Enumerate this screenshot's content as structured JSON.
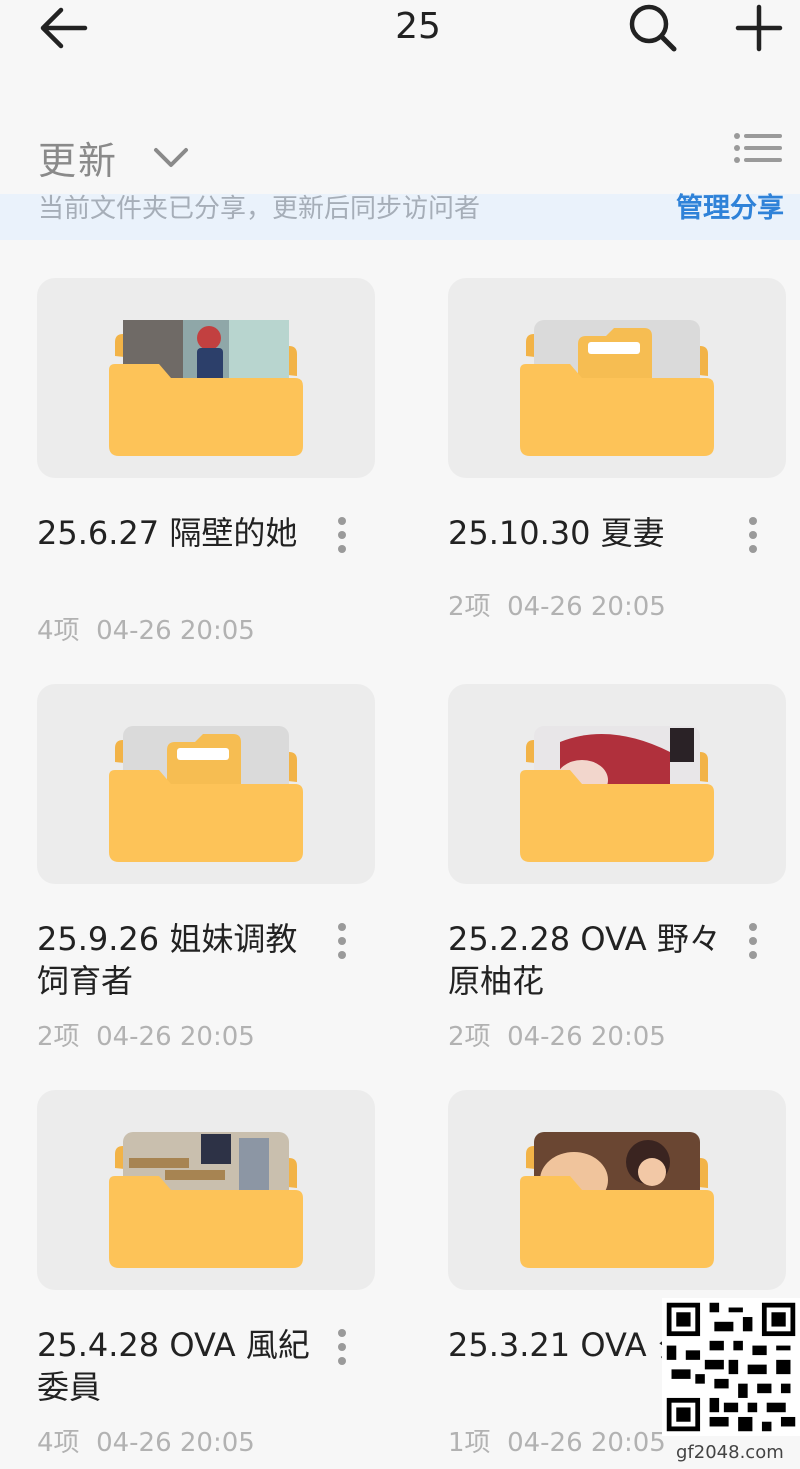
{
  "header": {
    "title": "25",
    "back_icon": "arrow-left-icon",
    "search_icon": "search-icon",
    "add_icon": "plus-icon"
  },
  "sortbar": {
    "label": "更新",
    "chevron_icon": "chevron-down-icon",
    "view_icon": "list-view-icon"
  },
  "share_banner": {
    "text": "当前文件夹已分享，更新后同步访问者",
    "action": "管理分享"
  },
  "folders": [
    {
      "name": "25.6.27 隔壁的她",
      "count": "4项",
      "time": "04-26 20:05",
      "thumb_style": "image"
    },
    {
      "name": "25.10.30 夏妻",
      "count": "2项",
      "time": "04-26 20:05",
      "thumb_style": "plain"
    },
    {
      "name": "25.9.26 姐妹调教饲育者",
      "count": "2项",
      "time": "04-26 20:05",
      "thumb_style": "plain"
    },
    {
      "name": "25.2.28 OVA 野々原柚花",
      "count": "2项",
      "time": "04-26 20:05",
      "thumb_style": "image"
    },
    {
      "name": "25.4.28 OVA 風紀委員",
      "count": "4项",
      "time": "04-26 20:05",
      "thumb_style": "image"
    },
    {
      "name": "25.3.21 OVA 夕颜",
      "count": "1项",
      "time": "04-26 20:05",
      "thumb_style": "image"
    }
  ],
  "watermark": "gf2048.com",
  "colors": {
    "folder": "#fdc358",
    "folder_back": "#f2b347",
    "accent": "#2f82d8"
  }
}
